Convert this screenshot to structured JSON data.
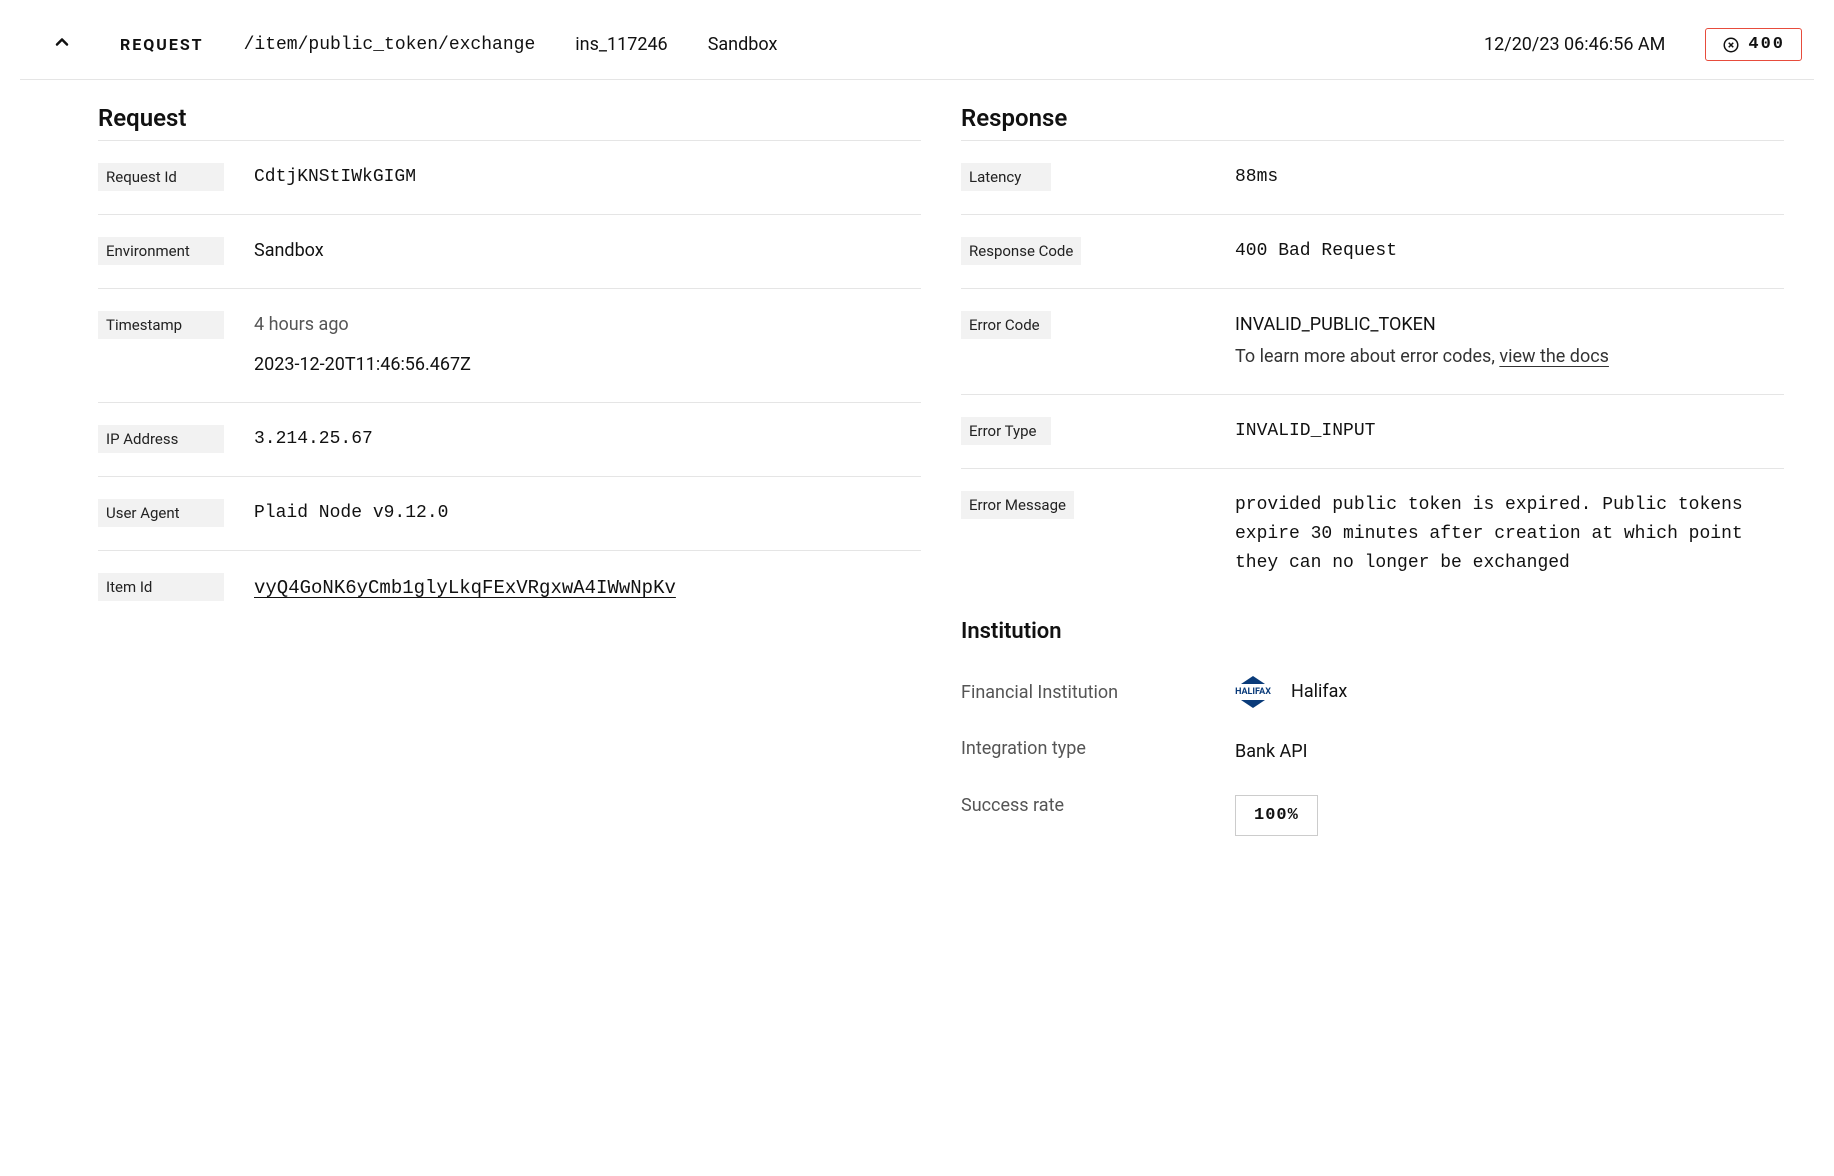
{
  "header": {
    "label": "REQUEST",
    "path": "/item/public_token/exchange",
    "institution_id": "ins_117246",
    "environment": "Sandbox",
    "timestamp": "12/20/23 06:46:56 AM",
    "status_code": "400"
  },
  "request": {
    "title": "Request",
    "fields": {
      "request_id": {
        "label": "Request Id",
        "value": "CdtjKNStIWkGIGM"
      },
      "environment": {
        "label": "Environment",
        "value": "Sandbox"
      },
      "timestamp": {
        "label": "Timestamp",
        "relative": "4 hours ago",
        "iso": "2023-12-20T11:46:56.467Z"
      },
      "ip_address": {
        "label": "IP Address",
        "value": "3.214.25.67"
      },
      "user_agent": {
        "label": "User Agent",
        "value": "Plaid Node v9.12.0"
      },
      "item_id": {
        "label": "Item Id",
        "value": "vyQ4GoNK6yCmb1glyLkqFExVRgxwA4IWwNpKv"
      }
    }
  },
  "response": {
    "title": "Response",
    "fields": {
      "latency": {
        "label": "Latency",
        "value": "88ms"
      },
      "response_code": {
        "label": "Response Code",
        "value": "400 Bad Request"
      },
      "error_code": {
        "label": "Error Code",
        "value": "INVALID_PUBLIC_TOKEN",
        "helper": "To learn more about error codes, ",
        "link": "view the docs"
      },
      "error_type": {
        "label": "Error Type",
        "value": "INVALID_INPUT"
      },
      "error_message": {
        "label": "Error Message",
        "value": "provided public token is expired. Public tokens expire 30 minutes after creation at which point they can no longer be exchanged"
      }
    },
    "institution": {
      "title": "Institution",
      "financial_institution": {
        "label": "Financial Institution",
        "value": "Halifax",
        "logo_text": "HALIFAX"
      },
      "integration_type": {
        "label": "Integration type",
        "value": "Bank API"
      },
      "success_rate": {
        "label": "Success rate",
        "value": "100%"
      }
    }
  }
}
